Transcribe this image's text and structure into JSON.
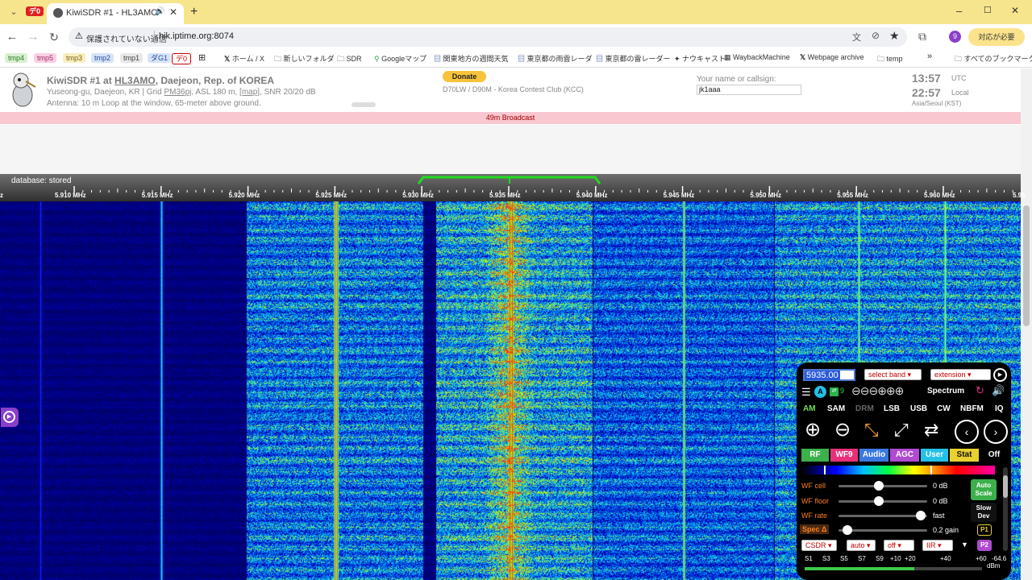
{
  "browser": {
    "tab_title": "KiwiSDR #1 - HL3AMO",
    "tab_badge": "デ0",
    "url_warning": "保護されていない通信",
    "url": "hik.iptime.org:8074",
    "profile_initial": "9",
    "action_label": "対応が必要",
    "window_controls": {
      "minimize": "–",
      "maximize": "☐",
      "close": "✕"
    }
  },
  "bookmarks": {
    "pills": [
      "tmp4",
      "tmp5",
      "tmp3",
      "tmp2",
      "tmp1",
      "ダG1",
      "デ0"
    ],
    "items": [
      "ホーム / X",
      "新しいフォルダ",
      "SDR",
      "Googleマップ",
      "関東地方の週間天気",
      "東京都の雨雲レーダ",
      "東京都の雷レーダー",
      "ナウキャスト",
      "WaybackMachine",
      "Webpage archive",
      "temp"
    ],
    "more": "»",
    "all": "すべてのブックマーク"
  },
  "kiwi": {
    "title_prefix": "KiwiSDR #1 at ",
    "callsign": "HL3AMO",
    "title_suffix": ", Daejeon, Rep. of KOREA",
    "loc_prefix": "Yuseong-gu, Daejeon, KR | Grid ",
    "grid": "PM36pj",
    "loc_mid": ", ASL 180 m, ",
    "map": "[map]",
    "loc_suffix": ", SNR 20/20 dB",
    "antenna": "Antenna: 10 m Loop at the window, 65-meter above ground.",
    "donate": "Donate",
    "station": "D70LW / D90M - Korea Contest Club (KCC)",
    "name_label": "Your name or callsign:",
    "name_value": "jk1aaa",
    "utc_time": "13:57",
    "utc_label": "UTC",
    "local_time": "22:57",
    "local_label": "Local",
    "timezone": "Asia/Seoul (KST)",
    "band_bar": "49m Broadcast",
    "db_status": "database: stored"
  },
  "scale": {
    "ticks": [
      "5.910 MHz",
      "5.915 MHz",
      "5.920 MHz",
      "5.925 MHz",
      "5.930 MHz",
      "5.935 MHz",
      "5.940 MHz",
      "5.945 MHz",
      "5.950 MHz",
      "5.955 MHz",
      "5.960 MHz"
    ],
    "edge_left": "z",
    "edge_right": "5.96"
  },
  "panel": {
    "freq": "5935.00",
    "band_select": "select band",
    "ext_select": "extension",
    "spectrum": "Spectrum",
    "ab": "A",
    "ab_num": "9",
    "modes": [
      "AM",
      "SAM",
      "DRM",
      "LSB",
      "USB",
      "CW",
      "NBFM",
      "IQ"
    ],
    "tabs": [
      "RF",
      "WF9",
      "Audio",
      "AGC",
      "User",
      "Stat",
      "Off"
    ],
    "sliders": [
      {
        "label": "WF cell",
        "value": "0 dB",
        "level": 0.45
      },
      {
        "label": "WF floor",
        "value": "0 dB",
        "level": 0.45
      },
      {
        "label": "WF rate",
        "value": "fast",
        "level": 0.93
      },
      {
        "label": "Spec Δ",
        "value": "0.2 gain",
        "level": 0.1
      }
    ],
    "auto_scale": [
      "Auto",
      "Scale"
    ],
    "slow_dev": [
      "Slow",
      "Dev"
    ],
    "p1": "P1",
    "p2": "P2",
    "bottom_selects": [
      "CSDR",
      "auto",
      "off",
      "IIR"
    ],
    "smeter": [
      "S1",
      "S3",
      "S5",
      "S7",
      "S9",
      "+10",
      "+20",
      "+40",
      "+60",
      "-64.6"
    ],
    "dbm": "dBm",
    "smeter_level": 0.62
  }
}
